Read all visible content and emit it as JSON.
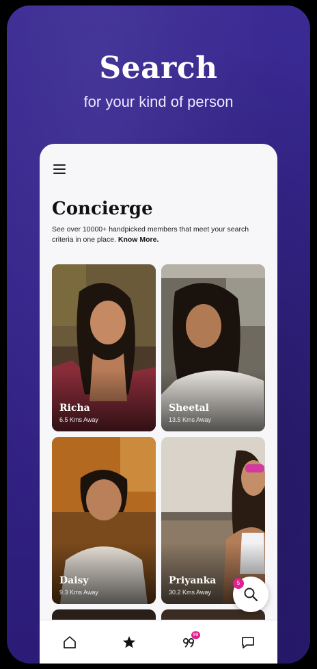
{
  "hero": {
    "title": "Search",
    "subtitle": "for your kind of person"
  },
  "page": {
    "title": "Concierge",
    "description": "See over 10000+ handpicked members that meet your search criteria in one place.",
    "know_more": "Know More."
  },
  "profiles": [
    {
      "name": "Richa",
      "distance": "6.5 Kms Away"
    },
    {
      "name": "Sheetal",
      "distance": "13.5 Kms Away"
    },
    {
      "name": "Daisy",
      "distance": "9.3 Kms Away"
    },
    {
      "name": "Priyanka",
      "distance": "30.2 Kms Away"
    }
  ],
  "fab": {
    "icon": "search-icon",
    "badge": "5"
  },
  "tabs": [
    {
      "icon": "home-icon"
    },
    {
      "icon": "star-icon"
    },
    {
      "icon": "quote-icon",
      "badge": "99"
    },
    {
      "icon": "chat-icon"
    }
  ],
  "colors": {
    "background": "#34238a",
    "accent": "#e0208f",
    "screen": "#f7f6f8"
  }
}
